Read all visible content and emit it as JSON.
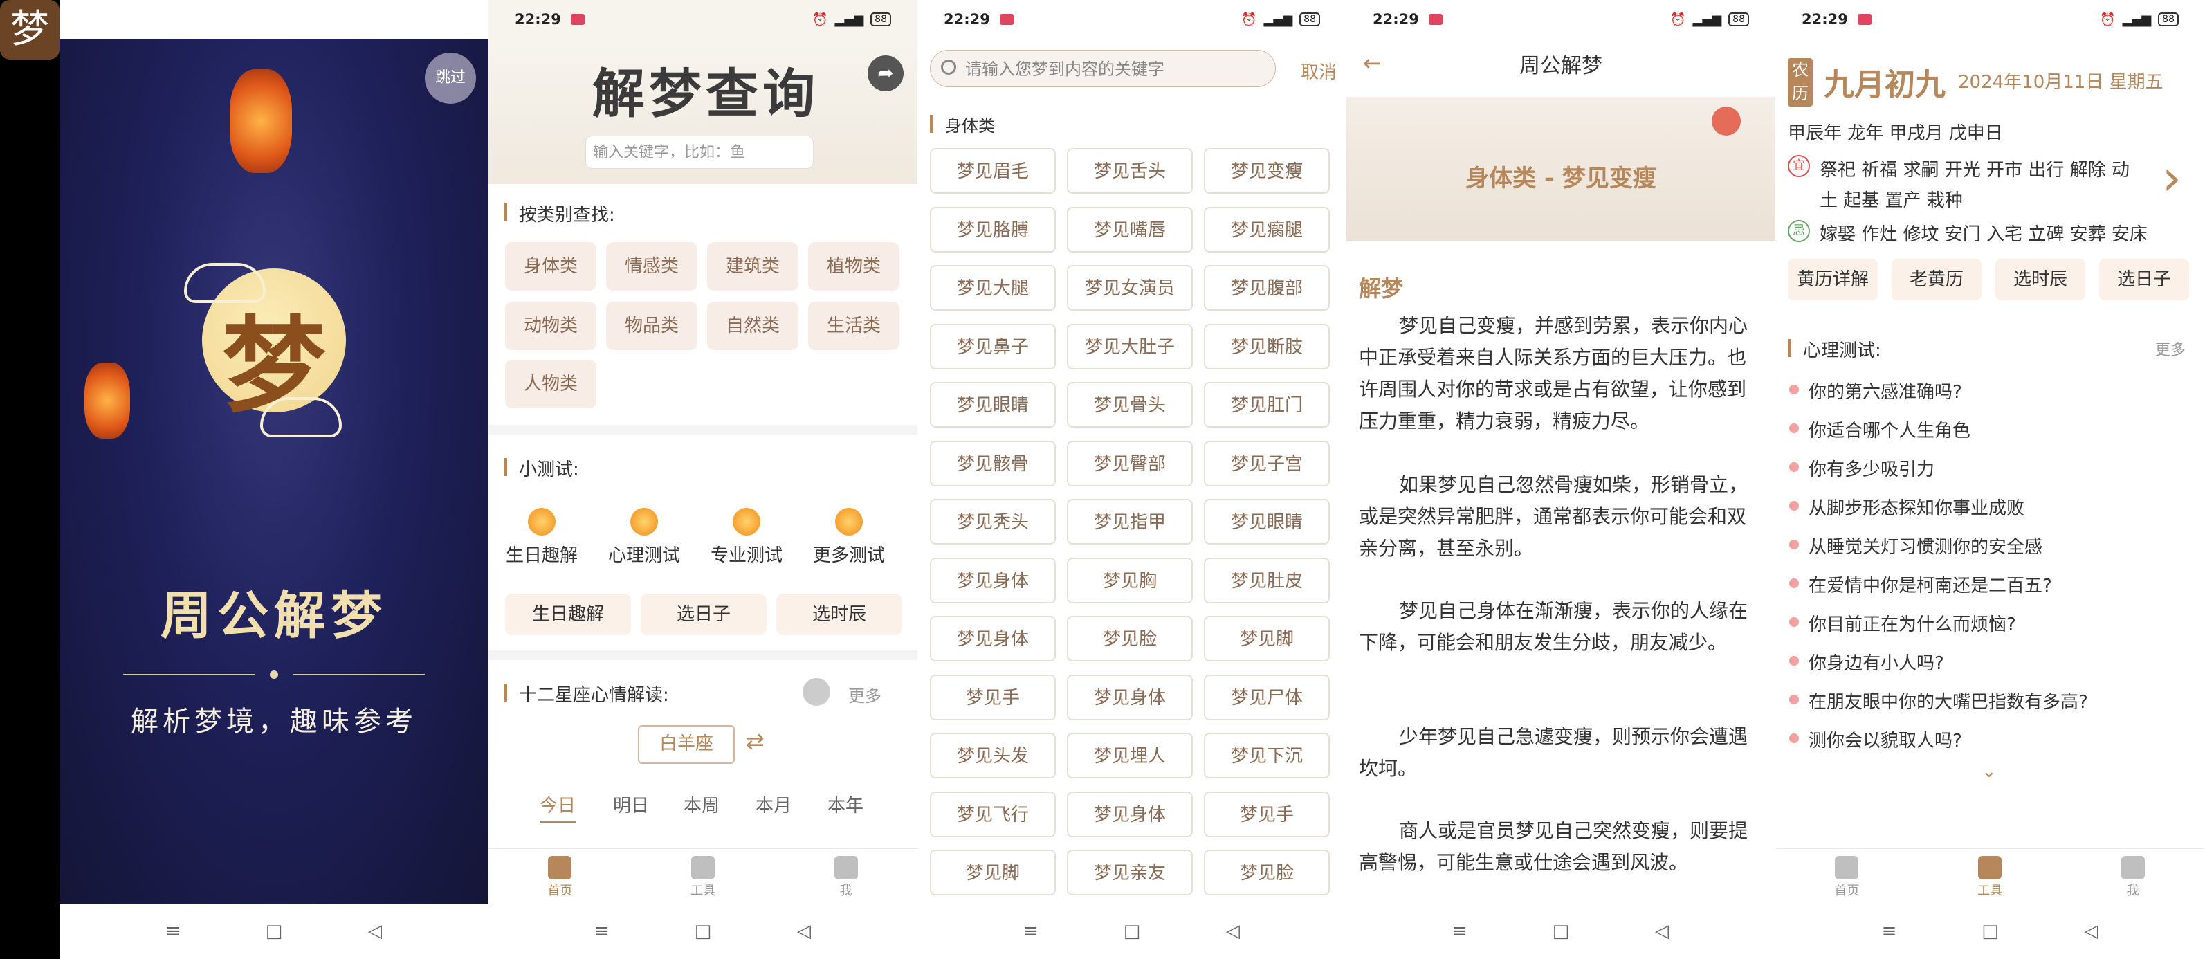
{
  "screens": {
    "s1": {
      "skip_label": "跳过",
      "meng_char": "梦",
      "title": "周公解梦",
      "subtitle": "解析梦境，趣味参考"
    },
    "s2": {
      "status": {
        "time": "22:29",
        "battery": "88"
      },
      "banner_title": "解梦查询",
      "search_placeholder": "输入关键字，比如：鱼",
      "category_title": "按类别查找:",
      "categories": [
        "身体类",
        "情感类",
        "建筑类",
        "植物类",
        "动物类",
        "物品类",
        "自然类",
        "生活类",
        "人物类"
      ],
      "test_title": "小测试:",
      "tests": [
        "生日趣解",
        "心理测试",
        "专业测试",
        "更多测试"
      ],
      "test_buttons": [
        "生日趣解",
        "选日子",
        "选时辰"
      ],
      "zodiac_title": "十二星座心情解读:",
      "zodiac_more": "更多",
      "zodiac_select": "白羊座",
      "tabs": [
        "今日",
        "明日",
        "本周",
        "本月",
        "本年"
      ],
      "bottom_nav": [
        "首页",
        "工具",
        "我"
      ]
    },
    "s3": {
      "status": {
        "time": "22:29",
        "battery": "88"
      },
      "search_placeholder": "请输入您梦到内容的关键字",
      "cancel_label": "取消",
      "section_title": "身体类",
      "items": [
        "梦见眉毛",
        "梦见舌头",
        "梦见变瘦",
        "梦见胳膊",
        "梦见嘴唇",
        "梦见瘸腿",
        "梦见大腿",
        "梦见女演员",
        "梦见腹部",
        "梦见鼻子",
        "梦见大肚子",
        "梦见断肢",
        "梦见眼睛",
        "梦见骨头",
        "梦见肛门",
        "梦见骸骨",
        "梦见臀部",
        "梦见子宫",
        "梦见秃头",
        "梦见指甲",
        "梦见眼睛",
        "梦见身体",
        "梦见胸",
        "梦见肚皮",
        "梦见身体",
        "梦见脸",
        "梦见脚",
        "梦见手",
        "梦见身体",
        "梦见尸体",
        "梦见头发",
        "梦见埋人",
        "梦见下沉",
        "梦见飞行",
        "梦见身体",
        "梦见手",
        "梦见脚",
        "梦见亲友",
        "梦见脸"
      ]
    },
    "s4": {
      "status": {
        "time": "22:29",
        "battery": "88"
      },
      "header": "周公解梦",
      "art_title": "身体类 - 梦见变瘦",
      "section": "解梦",
      "paragraphs": [
        "梦见自己变瘦，并感到劳累，表示你内心中正承受着来自人际关系方面的巨大压力。也许周围人对你的苛求或是占有欲望，让你感到压力重重，精力衰弱，精疲力尽。",
        "如果梦见自己忽然骨瘦如柴，形销骨立，或是突然异常肥胖，通常都表示你可能会和双亲分离，甚至永别。",
        "梦见自己身体在渐渐瘦，表示你的人缘在下降，可能会和朋友发生分歧，朋友减少。",
        "少年梦见自己急遽变瘦，则预示你会遭遇坎坷。",
        "商人或是官员梦见自己突然变瘦，则要提高警惕，可能生意或仕途会遇到风波。"
      ]
    },
    "s5": {
      "status": {
        "time": "22:29",
        "battery": "88"
      },
      "nongli": "农历",
      "lunar_date": "九月初九",
      "solar_date": "2024年10月11日 星期五",
      "ganzhi": "甲辰年 龙年 甲戌月 戊申日",
      "yi_badge": "宜",
      "yi": "祭祀 祈福 求嗣 开光 开市 出行 解除 动土 起基 置产 栽种",
      "ji_badge": "忌",
      "ji": "嫁娶 作灶 修坟 安门 入宅 立碑 安葬 安床",
      "buttons": [
        "黄历详解",
        "老黄历",
        "选时辰",
        "选日子"
      ],
      "psych_title": "心理测试:",
      "psych_more": "更多",
      "psych_list": [
        "你的第六感准确吗?",
        "你适合哪个人生角色",
        "你有多少吸引力",
        "从脚步形态探知你事业成败",
        "从睡觉关灯习惯测你的安全感",
        "在爱情中你是柯南还是二百五?",
        "你目前正在为什么而烦恼?",
        "你身边有小人吗?",
        "在朋友眼中你的大嘴巴指数有多高?",
        "测你会以貌取人吗?"
      ],
      "bottom_nav": [
        "首页",
        "工具",
        "我"
      ]
    }
  },
  "colors": {
    "accent": "#b6875a",
    "chip_bg": "#f7ece6",
    "splash_sky": "#1e2059"
  }
}
